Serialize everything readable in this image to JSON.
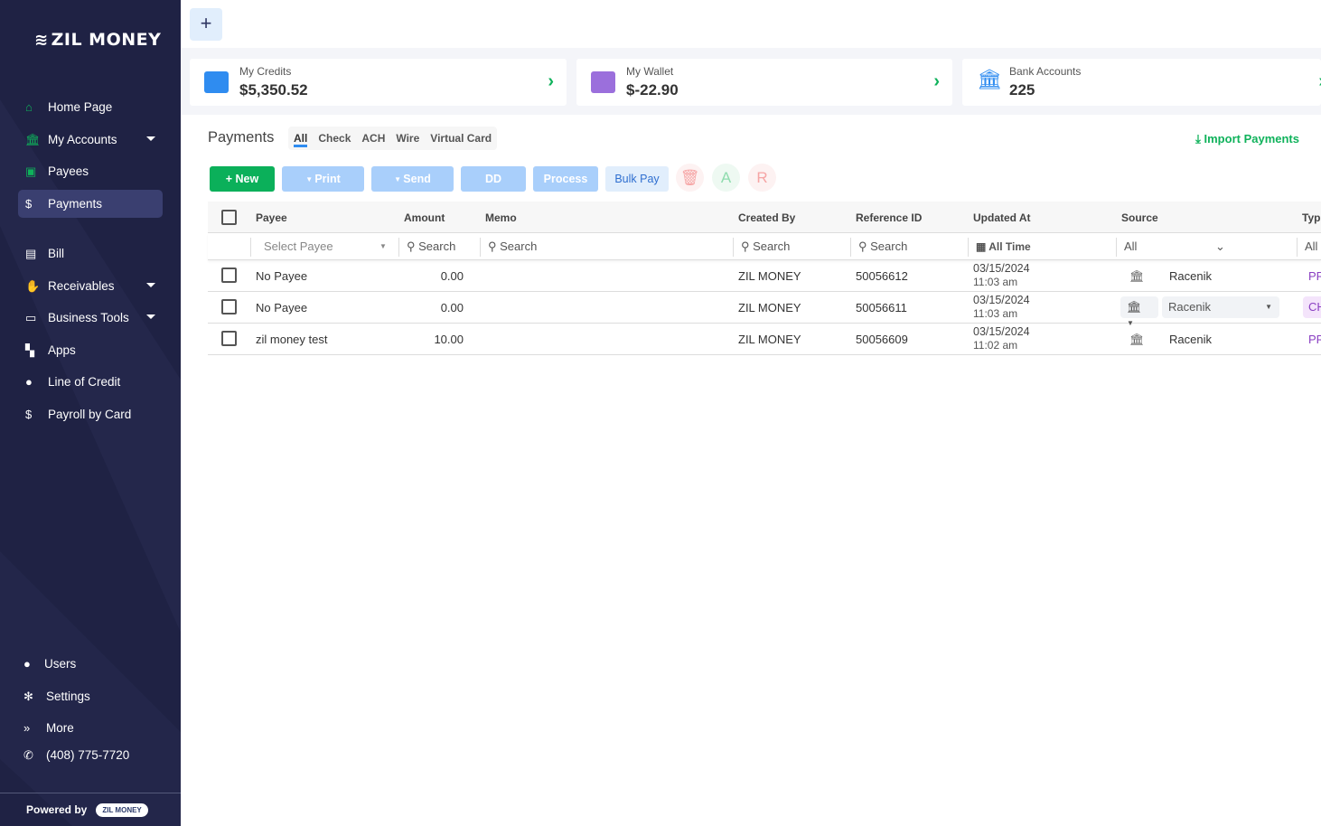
{
  "brand": {
    "logo": "ZIL MONEY",
    "powered_by": "Powered by",
    "badge": "ZIL MONEY"
  },
  "sidebar": {
    "items": [
      {
        "label": "Home Page",
        "icon": "home-icon"
      },
      {
        "label": "My Accounts",
        "icon": "bank-icon"
      },
      {
        "label": "Payees",
        "icon": "contact-book-icon"
      },
      {
        "label": "Payments",
        "icon": "dollar-icon"
      },
      {
        "label": "Bill",
        "icon": "file-icon"
      },
      {
        "label": "Receivables",
        "icon": "hand-money-icon"
      },
      {
        "label": "Business Tools",
        "icon": "toolbox-icon"
      },
      {
        "label": "Apps",
        "icon": "grid-icon"
      },
      {
        "label": "Line of Credit",
        "icon": "money-bag-icon"
      },
      {
        "label": "Payroll by Card",
        "icon": "dollar-icon"
      }
    ],
    "bottom": [
      {
        "label": "Users"
      },
      {
        "label": "Settings"
      },
      {
        "label": "More"
      },
      {
        "label": "(408) 775-7720"
      }
    ]
  },
  "cards": [
    {
      "label": "My Credits",
      "value": "$5,350.52"
    },
    {
      "label": "My Wallet",
      "value": "$-22.90"
    },
    {
      "label": "Bank Accounts",
      "value": "225"
    }
  ],
  "page": {
    "title": "Payments",
    "tabs": [
      "All",
      "Check",
      "ACH",
      "Wire",
      "Virtual Card"
    ],
    "import": "Import Payments"
  },
  "toolbar": {
    "new": "New",
    "print": "Print",
    "send": "Send",
    "dd": "DD",
    "process": "Process",
    "bulk": "Bulk Pay",
    "approve": "A",
    "reject": "R"
  },
  "table": {
    "headers": [
      "Payee",
      "Amount",
      "Memo",
      "Created By",
      "Reference ID",
      "Updated At",
      "Source",
      "Type"
    ],
    "filters": {
      "payee": "Select Payee",
      "search": "Search",
      "date": "All Time",
      "source": "All",
      "type": "All"
    },
    "rows": [
      {
        "payee": "No Payee",
        "amount": "0.00",
        "created_by": "ZIL MONEY",
        "ref": "50056612",
        "date": "03/15/2024",
        "time": "11:03 am",
        "source": "Racenik",
        "type": "PR"
      },
      {
        "payee": "No Payee",
        "amount": "0.00",
        "created_by": "ZIL MONEY",
        "ref": "50056611",
        "date": "03/15/2024",
        "time": "11:03 am",
        "source": "Racenik",
        "type": "CH"
      },
      {
        "payee": "zil money test",
        "amount": "10.00",
        "created_by": "ZIL MONEY",
        "ref": "50056609",
        "date": "03/15/2024",
        "time": "11:02 am",
        "source": "Racenik",
        "type": "PR"
      }
    ]
  }
}
